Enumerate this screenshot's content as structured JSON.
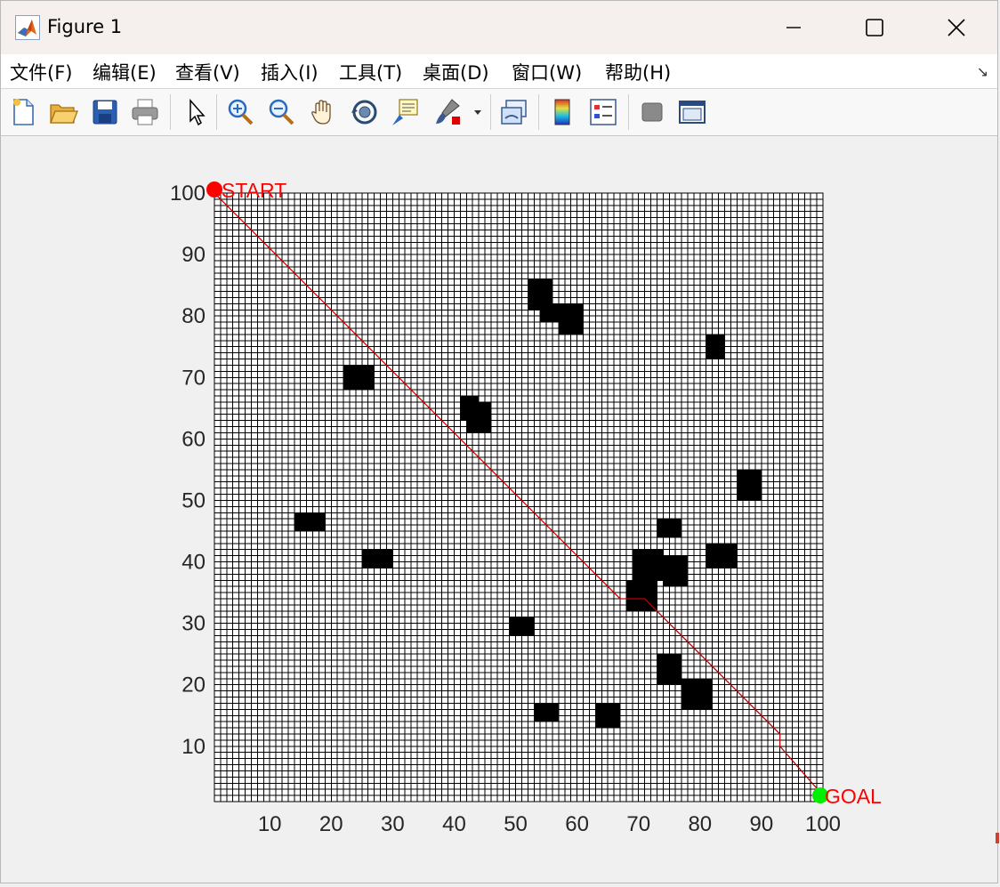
{
  "window": {
    "title": "Figure 1",
    "controls": [
      "minimize",
      "maximize",
      "close"
    ]
  },
  "menubar": {
    "items": [
      "文件(F)",
      "编辑(E)",
      "查看(V)",
      "插入(I)",
      "工具(T)",
      "桌面(D)",
      "窗口(W)",
      "帮助(H)"
    ],
    "overflow_arrow": "↘"
  },
  "toolbar": {
    "buttons": [
      "new-figure-icon",
      "open-file-icon",
      "save-icon",
      "print-icon",
      "pointer-icon",
      "zoom-in-icon",
      "zoom-out-icon",
      "pan-hand-icon",
      "rotate-3d-icon",
      "data-cursor-icon",
      "brush-icon",
      "link-plot-icon",
      "colorbar-icon",
      "legend-icon",
      "hide-plot-tools-icon",
      "show-plot-tools-icon"
    ]
  },
  "chart_data": {
    "type": "scatter",
    "title": "",
    "xlabel": "",
    "ylabel": "",
    "xlim": [
      1,
      100
    ],
    "ylim": [
      1,
      100
    ],
    "xticks": [
      10,
      20,
      30,
      40,
      50,
      60,
      70,
      80,
      90,
      100
    ],
    "yticks": [
      10,
      20,
      30,
      40,
      50,
      60,
      70,
      80,
      90,
      100
    ],
    "grid": "every cell (100x100)",
    "obstacles": [
      [
        52,
        81,
        56,
        86
      ],
      [
        54,
        79,
        57,
        82
      ],
      [
        57,
        77,
        61,
        82
      ],
      [
        81,
        73,
        84,
        77
      ],
      [
        22,
        68,
        27,
        72
      ],
      [
        41,
        63,
        44,
        67
      ],
      [
        42,
        61,
        46,
        66
      ],
      [
        86,
        50,
        90,
        55
      ],
      [
        14,
        45,
        19,
        48
      ],
      [
        73,
        44,
        77,
        47
      ],
      [
        81,
        39,
        86,
        43
      ],
      [
        25,
        39,
        30,
        42
      ],
      [
        69,
        37,
        74,
        42
      ],
      [
        74,
        36,
        78,
        41
      ],
      [
        68,
        32,
        73,
        37
      ],
      [
        49,
        28,
        53,
        31
      ],
      [
        73,
        20,
        77,
        25
      ],
      [
        77,
        16,
        82,
        21
      ],
      [
        53,
        14,
        57,
        17
      ],
      [
        63,
        13,
        67,
        17
      ]
    ],
    "path": [
      [
        1,
        100
      ],
      [
        67,
        34
      ],
      [
        71,
        34
      ],
      [
        93,
        12
      ],
      [
        93,
        10
      ],
      [
        100,
        2
      ]
    ],
    "start": {
      "x": 1,
      "y": 100,
      "label": "START",
      "color": "#ff0000"
    },
    "goal": {
      "x": 100,
      "y": 2,
      "label": "GOAL",
      "color": "#00ee00"
    },
    "path_color": "#c00000",
    "label_color": "#ff0000"
  }
}
